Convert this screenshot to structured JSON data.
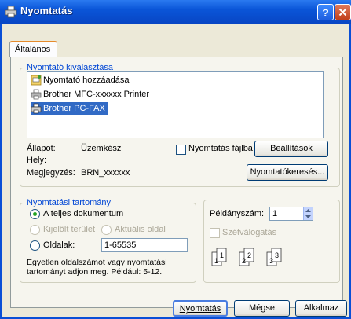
{
  "window": {
    "title": "Nyomtatás",
    "help": "?",
    "close": "✕"
  },
  "tab": {
    "label": "Általános"
  },
  "printer_group": {
    "legend": "Nyomtató kiválasztása",
    "items": [
      {
        "label": "Nyomtató hozzáadása",
        "icon": "add-printer-icon",
        "selected": false
      },
      {
        "label": "Brother MFC-xxxxxx  Printer",
        "icon": "printer-icon",
        "selected": false
      },
      {
        "label": "Brother PC-FAX",
        "icon": "fax-printer-icon",
        "selected": true
      }
    ],
    "status_label": "Állapot:",
    "status_value": "Üzemkész",
    "location_label": "Hely:",
    "location_value": "",
    "comment_label": "Megjegyzés:",
    "comment_value": "BRN_xxxxxx",
    "print_to_file": "Nyomtatás fájlba",
    "settings_button": "Beállítások",
    "find_button": "Nyomtatókeresés..."
  },
  "range_group": {
    "legend": "Nyomtatási tartomány",
    "all": "A teljes dokumentum",
    "selection": "Kijelölt terület",
    "current": "Aktuális oldal",
    "pages": "Oldalak:",
    "pages_value": "1-65535",
    "hint": "Egyetlen oldalszámot vagy nyomtatási tartományt adjon meg. Például: 5-12."
  },
  "copies": {
    "label": "Példányszám:",
    "value": "1",
    "collate": "Szétválogatás"
  },
  "footer": {
    "print": "Nyomtatás",
    "cancel": "Mégse",
    "apply": "Alkalmaz"
  }
}
